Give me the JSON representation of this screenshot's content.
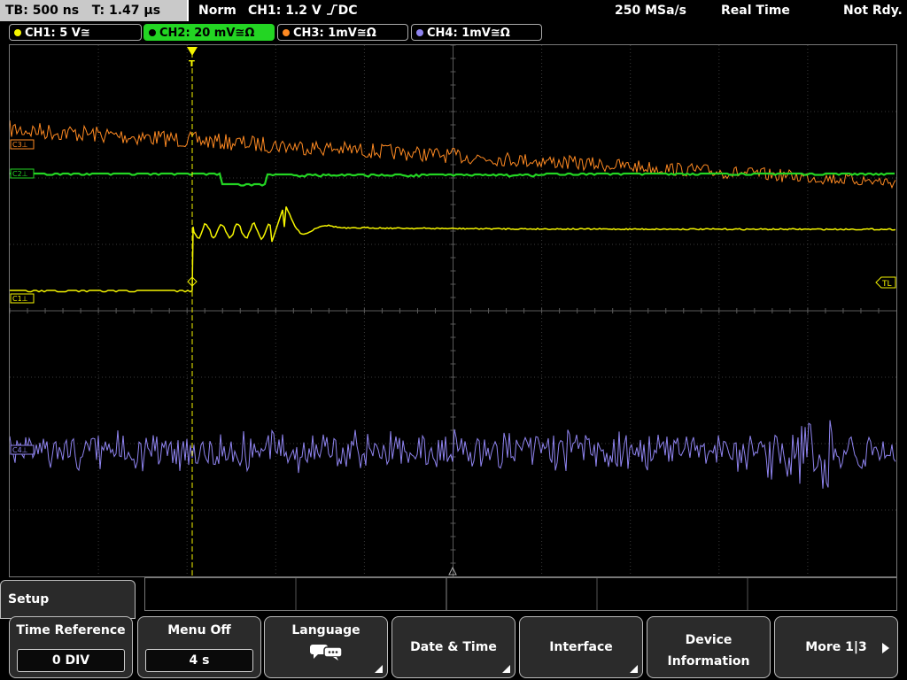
{
  "status_bar": {
    "timebase": "TB: 500 ns",
    "trigger_time": "T: 1.47 µs",
    "trigger_mode": "Norm",
    "trigger_source": "CH1: 1.2 V",
    "trigger_slope_icon": "rising-edge",
    "trigger_coupling": "DC",
    "sample_rate": "250 MSa/s",
    "acq_mode": "Real Time",
    "status": "Not Rdy."
  },
  "channels": [
    {
      "label": "CH1: 5 V",
      "coupling_symbol": "≅",
      "color": "#f5f500",
      "active": false
    },
    {
      "label": "CH2: 20 mV",
      "coupling_symbol": "≅Ω",
      "color": "#23d523",
      "active": true
    },
    {
      "label": "CH3: 1mV",
      "coupling_symbol": "≅Ω",
      "color": "#ff8a22",
      "active": false
    },
    {
      "label": "CH4: 1mV",
      "coupling_symbol": "≅Ω",
      "color": "#8f84f0",
      "active": false
    }
  ],
  "markers": {
    "ch1": "C1⊥",
    "ch2": "C2⊥",
    "ch3": "C3⊥",
    "ch4": "C4⊥",
    "trigger_level": "TL",
    "trigger_pos": "T"
  },
  "menu": {
    "title": "Setup",
    "softkeys": [
      {
        "label": "Time Reference",
        "value": "0 DIV"
      },
      {
        "label": "Menu Off",
        "value": "4 s"
      },
      {
        "label": "Language",
        "icon": "speech-bubbles-icon"
      },
      {
        "label": "Date & Time"
      },
      {
        "label": "Interface"
      },
      {
        "label_line1": "Device",
        "label_line2": "Information"
      },
      {
        "label": "More 1|3",
        "icon": "arrow-right-icon"
      }
    ]
  }
}
